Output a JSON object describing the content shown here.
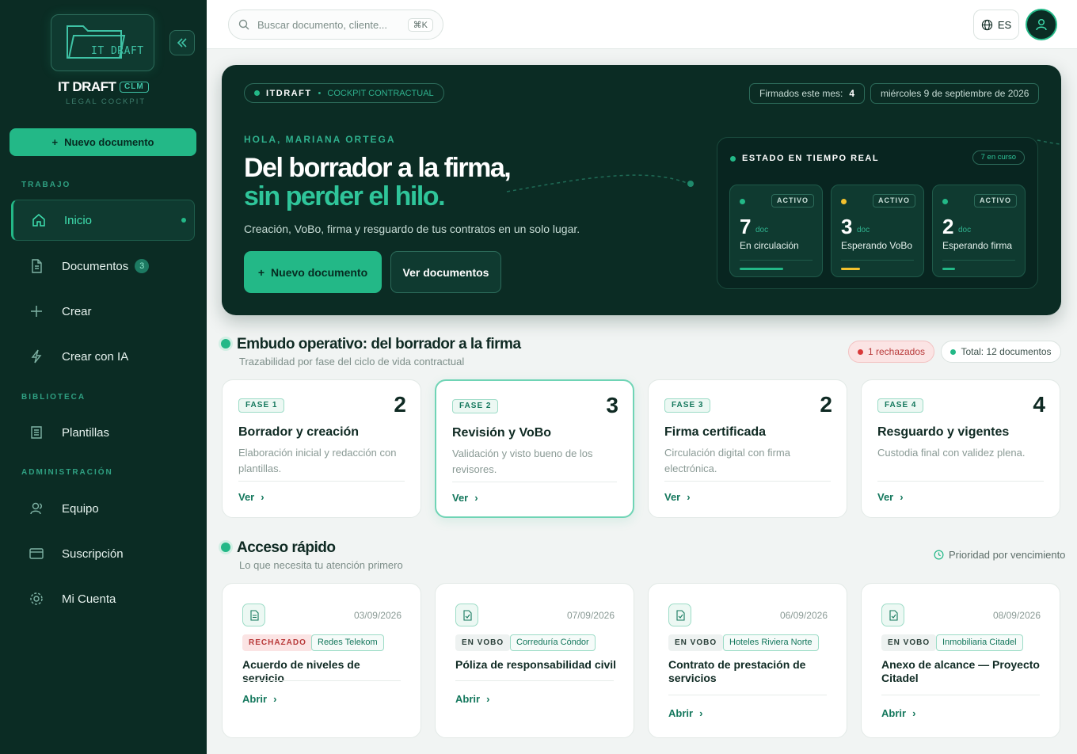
{
  "sidebar": {
    "logo_text": "IT DRAFT",
    "brand_name": "IT DRAFT",
    "brand_badge": "CLM",
    "brand_sub": "LEGAL COCKPIT",
    "new_doc": "Nuevo documento",
    "sections": {
      "work": "TRABAJO",
      "library": "BIBLIOTECA",
      "admin": "ADMINISTRACIÓN"
    },
    "items": [
      {
        "label": "Inicio",
        "icon": "home-icon"
      },
      {
        "label": "Documentos",
        "icon": "document-icon",
        "count": "3"
      },
      {
        "label": "Crear",
        "icon": "plus-icon"
      },
      {
        "label": "Crear con IA",
        "icon": "lightning-icon"
      },
      {
        "label": "Plantillas",
        "icon": "template-icon"
      },
      {
        "label": "Equipo",
        "icon": "team-icon"
      },
      {
        "label": "Suscripción",
        "icon": "card-icon"
      },
      {
        "label": "Mi Cuenta",
        "icon": "gear-icon"
      }
    ]
  },
  "topbar": {
    "search_placeholder": "Buscar documento, cliente...",
    "shortcut": "⌘K",
    "lang": "ES"
  },
  "hero": {
    "pill_brand": "ITDRAFT",
    "pill_section": "COCKPIT CONTRACTUAL",
    "signed_label": "Firmados este mes:",
    "signed_value": "4",
    "date": "miércoles 9 de septiembre de 2026",
    "greeting": "HOLA, MARIANA ORTEGA",
    "headline_1": "Del borrador a la firma,",
    "headline_2": "sin perder el hilo.",
    "subtitle": "Creación, VoBo, firma y resguardo de tus contratos en un solo lugar.",
    "btn_new": "Nuevo documento",
    "btn_view": "Ver documentos",
    "status": {
      "title": "ESTADO EN TIEMPO REAL",
      "badge": "7 en curso",
      "cards": [
        {
          "tag": "ACTIVO",
          "num": "7",
          "unit": "doc",
          "label": "En circulación",
          "color": "#23b887",
          "level": 0.58
        },
        {
          "tag": "ACTIVO",
          "num": "3",
          "unit": "doc",
          "label": "Esperando VoBo",
          "color": "#f2c12e",
          "level": 0.25
        },
        {
          "tag": "ACTIVO",
          "num": "2",
          "unit": "doc",
          "label": "Esperando firma",
          "color": "#23b887",
          "level": 0.17
        }
      ]
    }
  },
  "funnel": {
    "title": "Embudo operativo: del borrador a la firma",
    "subtitle": "Trazabilidad por fase del ciclo de vida contractual",
    "rejected": "1 rechazados",
    "total": "Total: 12 documentos",
    "phases": [
      {
        "fase": "FASE 1",
        "count": "2",
        "title": "Borrador y creación",
        "desc": "Elaboración inicial y redacción con plantillas.",
        "link": "Ver"
      },
      {
        "fase": "FASE 2",
        "count": "3",
        "title": "Revisión y VoBo",
        "desc": "Validación y visto bueno de los revisores.",
        "link": "Ver"
      },
      {
        "fase": "FASE 3",
        "count": "2",
        "title": "Firma certificada",
        "desc": "Circulación digital con firma electrónica.",
        "link": "Ver"
      },
      {
        "fase": "FASE 4",
        "count": "4",
        "title": "Resguardo y vigentes",
        "desc": "Custodia final con validez plena.",
        "link": "Ver"
      }
    ]
  },
  "quick": {
    "title": "Acceso rápido",
    "subtitle": "Lo que necesita tu atención primero",
    "priority": "Prioridad por vencimiento",
    "cards": [
      {
        "date": "03/09/2026",
        "status": "RECHAZADO",
        "client": "Redes Telekom",
        "title": "Acuerdo de niveles de servicio",
        "link": "Abrir"
      },
      {
        "date": "07/09/2026",
        "status": "EN VOBO",
        "client": "Correduría Cóndor",
        "title": "Póliza de responsabilidad civil",
        "link": "Abrir"
      },
      {
        "date": "06/09/2026",
        "status": "EN VOBO",
        "client": "Hoteles Riviera Norte",
        "title": "Contrato de prestación de servicios",
        "link": "Abrir"
      },
      {
        "date": "08/09/2026",
        "status": "EN VOBO",
        "client": "Inmobiliaria Citadel",
        "title": "Anexo de alcance — Proyecto Citadel",
        "link": "Abrir"
      }
    ]
  },
  "colors": {
    "accent": "#23b887",
    "dark": "#0b2c24",
    "warning": "#f2c12e",
    "danger": "#d93a3a"
  }
}
